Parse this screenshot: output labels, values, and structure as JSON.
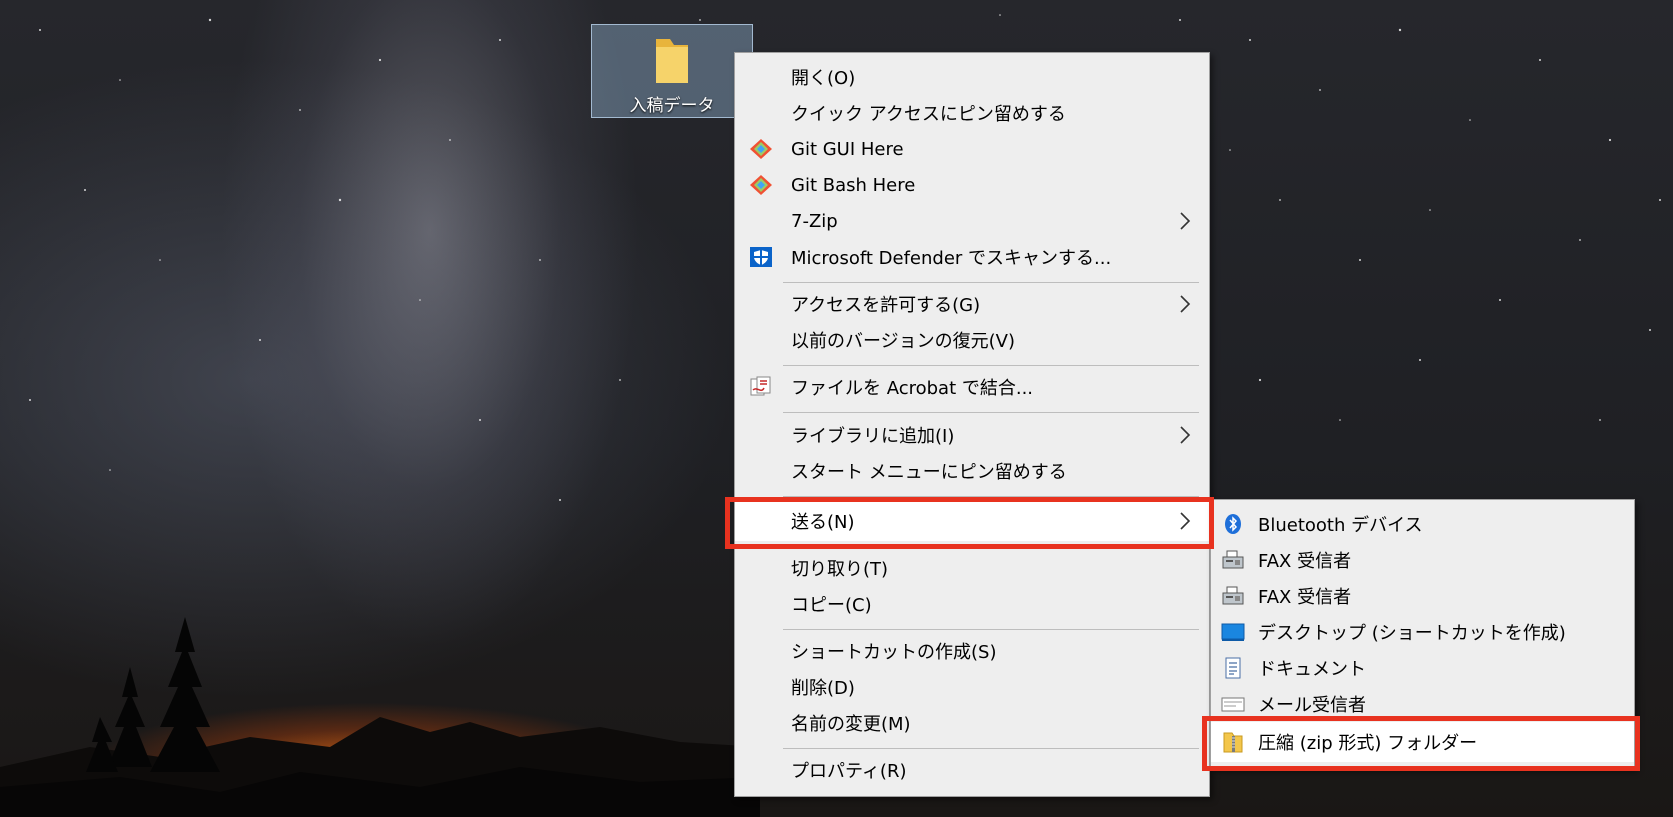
{
  "desktop": {
    "folder_label": "入稿データ"
  },
  "context_menu": {
    "items": [
      {
        "label": "開く(O)"
      },
      {
        "label": "クイック アクセスにピン留めする"
      },
      {
        "label": "Git GUI Here",
        "icon": "git-icon"
      },
      {
        "label": "Git Bash Here",
        "icon": "git-icon"
      },
      {
        "label": "7-Zip",
        "submenu": true
      },
      {
        "label": "Microsoft Defender でスキャンする...",
        "icon": "defender-shield-icon"
      },
      {
        "label": "アクセスを許可する(G)",
        "submenu": true
      },
      {
        "label": "以前のバージョンの復元(V)"
      },
      {
        "label": "ファイルを Acrobat で結合...",
        "icon": "acrobat-icon"
      },
      {
        "label": "ライブラリに追加(I)",
        "submenu": true
      },
      {
        "label": "スタート メニューにピン留めする"
      },
      {
        "label": "送る(N)",
        "submenu": true,
        "highlighted": true
      },
      {
        "label": "切り取り(T)"
      },
      {
        "label": "コピー(C)"
      },
      {
        "label": "ショートカットの作成(S)"
      },
      {
        "label": "削除(D)"
      },
      {
        "label": "名前の変更(M)"
      },
      {
        "label": "プロパティ(R)"
      }
    ]
  },
  "send_to_submenu": {
    "items": [
      {
        "label": "Bluetooth デバイス",
        "icon": "bluetooth-icon"
      },
      {
        "label": "FAX 受信者",
        "icon": "fax-icon"
      },
      {
        "label": "FAX 受信者",
        "icon": "fax-icon"
      },
      {
        "label": "デスクトップ (ショートカットを作成)",
        "icon": "desktop-icon"
      },
      {
        "label": "ドキュメント",
        "icon": "document-icon"
      },
      {
        "label": "メール受信者",
        "icon": "mail-icon"
      },
      {
        "label": "圧縮 (zip 形式) フォルダー",
        "icon": "zip-folder-icon",
        "highlighted": true
      }
    ]
  },
  "colors": {
    "menu_bg": "#eeeeee",
    "highlight_border": "#e8321f",
    "separator": "#bdbdbd"
  }
}
